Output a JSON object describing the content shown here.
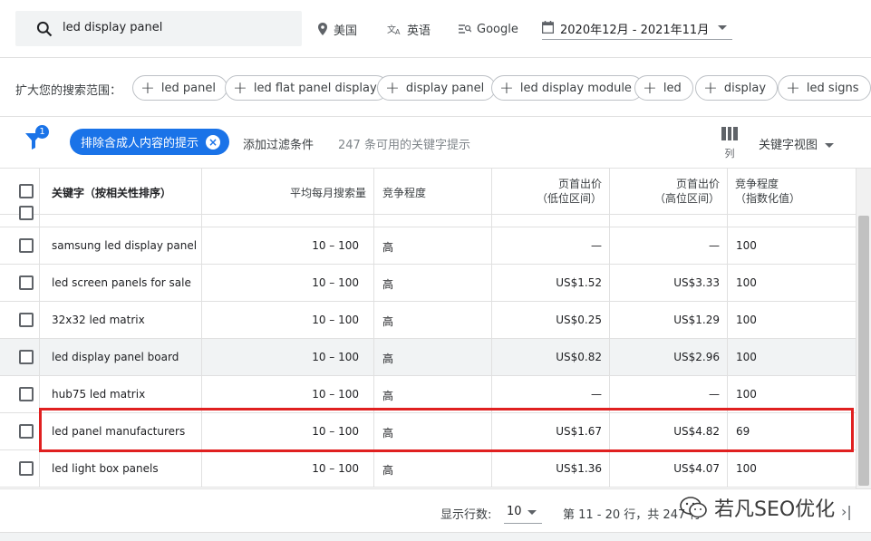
{
  "search": {
    "value": "led display panel"
  },
  "top_filters": {
    "location": "美国",
    "language": "英语",
    "network": "Google",
    "date_range": "2020年12月 - 2021年11月"
  },
  "expand": {
    "label": "扩大您的搜索范围：",
    "chips": [
      "led panel",
      "led flat panel display",
      "display panel",
      "led display module",
      "led",
      "display",
      "led signs"
    ]
  },
  "filters": {
    "badge": "1",
    "adult_chip": "排除含成人内容的提示",
    "add_filter": "添加过滤条件",
    "count_text": "247 条可用的关键字提示",
    "columns_label": "列",
    "view_select": "关键字视图"
  },
  "table": {
    "headers": {
      "keyword": "关键字（按相关性排序）",
      "volume": "平均每月搜索量",
      "competition": "竞争程度",
      "bid_low": [
        "页首出价",
        "（低位区间）"
      ],
      "bid_high": [
        "页首出价",
        "（高位区间）"
      ],
      "comp_index": [
        "竞争程度",
        "（指数化值）"
      ]
    },
    "rows": [
      {
        "keyword": "samsung led display panel",
        "volume": "10 – 100",
        "competition": "高",
        "bid_low": "—",
        "bid_high": "—",
        "index": "100"
      },
      {
        "keyword": "led screen panels for sale",
        "volume": "10 – 100",
        "competition": "高",
        "bid_low": "US$1.52",
        "bid_high": "US$3.33",
        "index": "100"
      },
      {
        "keyword": "32x32 led matrix",
        "volume": "10 – 100",
        "competition": "高",
        "bid_low": "US$0.25",
        "bid_high": "US$1.29",
        "index": "100"
      },
      {
        "keyword": "led display panel board",
        "volume": "10 – 100",
        "competition": "高",
        "bid_low": "US$0.82",
        "bid_high": "US$2.96",
        "index": "100"
      },
      {
        "keyword": "hub75 led matrix",
        "volume": "10 – 100",
        "competition": "高",
        "bid_low": "—",
        "bid_high": "—",
        "index": "100"
      },
      {
        "keyword": "led panel manufacturers",
        "volume": "10 – 100",
        "competition": "高",
        "bid_low": "US$1.67",
        "bid_high": "US$4.82",
        "index": "69"
      },
      {
        "keyword": "led light box panels",
        "volume": "10 – 100",
        "competition": "高",
        "bid_low": "US$1.36",
        "bid_high": "US$4.07",
        "index": "100"
      }
    ]
  },
  "footer": {
    "rows_label": "显示行数:",
    "rows_value": "10",
    "page_info": "第 11 - 20 行，共 247 行",
    "watermark": "若凡SEO优化"
  },
  "colors": {
    "accent": "#1a73e8",
    "highlight": "#e02020"
  }
}
